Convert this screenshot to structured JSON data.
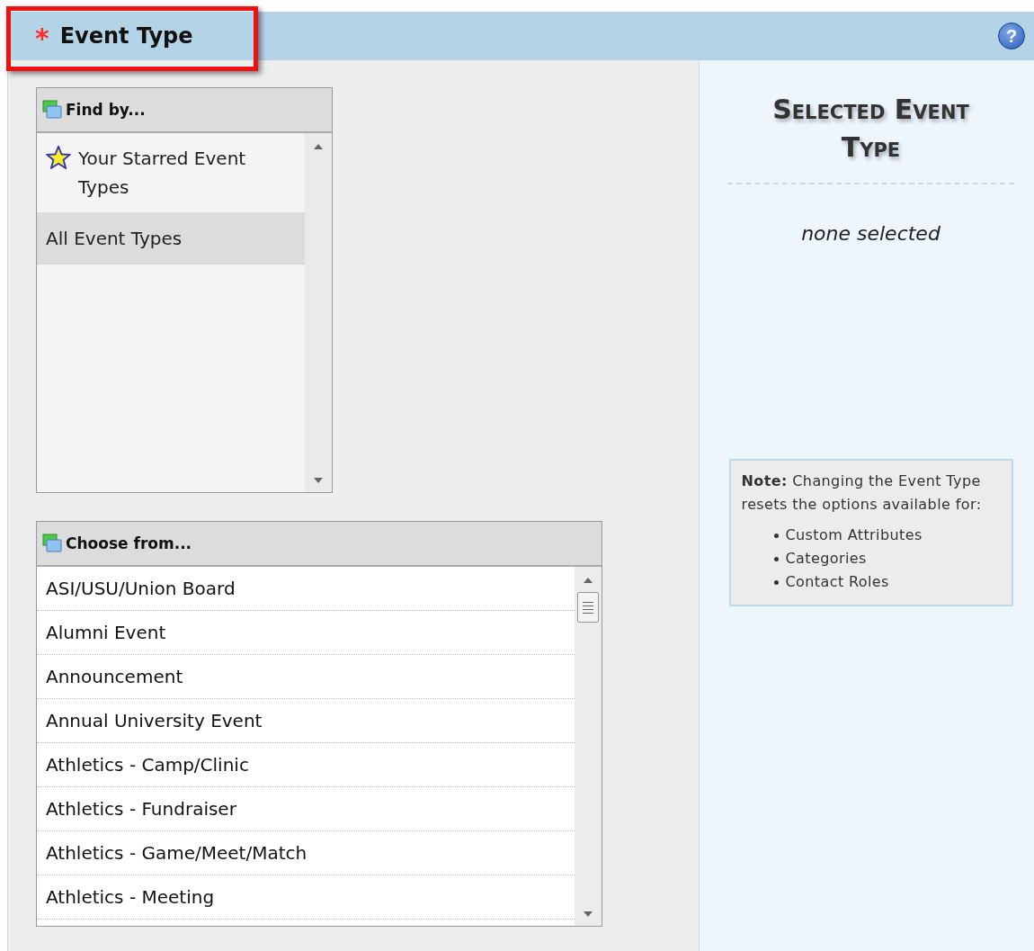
{
  "header": {
    "required_mark": "*",
    "title": "Event Type",
    "help_button": "?",
    "highlighted": true
  },
  "find_by": {
    "title": "Find by...",
    "items": [
      {
        "label": "Your Starred Event Types",
        "kind": "starred",
        "selected": false
      },
      {
        "label": "All Event Types",
        "kind": "plain",
        "selected": true
      }
    ]
  },
  "choose_from": {
    "title": "Choose from...",
    "items": [
      {
        "label": "ASI/USU/Union Board",
        "selected": false
      },
      {
        "label": "Alumni Event",
        "selected": false
      },
      {
        "label": "Announcement",
        "selected": false
      },
      {
        "label": "Annual University Event",
        "selected": false
      },
      {
        "label": "Athletics - Camp/Clinic",
        "selected": false
      },
      {
        "label": "Athletics - Fundraiser",
        "selected": false
      },
      {
        "label": "Athletics - Game/Meet/Match",
        "selected": false
      },
      {
        "label": "Athletics - Meeting",
        "selected": false
      }
    ]
  },
  "selected_panel": {
    "title": "Selected Event Type",
    "value": "none selected"
  },
  "note": {
    "text": "**Note:** Changing the Event Type resets the options available for:",
    "items": [
      "Custom Attributes",
      "Categories",
      "Contact Roles"
    ]
  }
}
